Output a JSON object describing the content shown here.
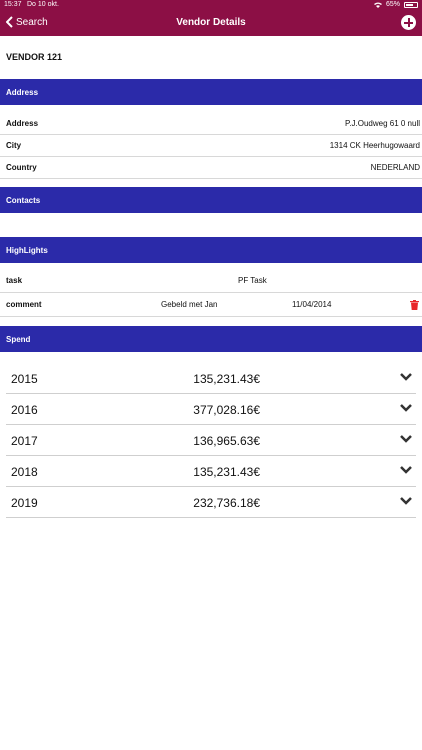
{
  "status": {
    "time": "15:37",
    "date": "Do 10 okt.",
    "battery": "65%"
  },
  "nav": {
    "back_label": "Search",
    "title": "Vendor Details"
  },
  "vendor": {
    "name": "VENDOR 121"
  },
  "address": {
    "header": "Address",
    "rows": [
      {
        "key": "Address",
        "value": "P.J.Oudweg 61 0 null"
      },
      {
        "key": "City",
        "value": "1314 CK Heerhugowaard"
      },
      {
        "key": "Country",
        "value": "NEDERLAND"
      }
    ]
  },
  "contacts": {
    "header": "Contacts"
  },
  "highlights": {
    "header": "HighLights",
    "task": {
      "key": "task",
      "value": "PF Task"
    },
    "comment": {
      "key": "comment",
      "text": "Gebeld met Jan",
      "date": "11/04/2014"
    }
  },
  "spend": {
    "header": "Spend",
    "rows": [
      {
        "year": "2015",
        "amount": "135,231.43€"
      },
      {
        "year": "2016",
        "amount": "377,028.16€"
      },
      {
        "year": "2017",
        "amount": "136,965.63€"
      },
      {
        "year": "2018",
        "amount": "135,231.43€"
      },
      {
        "year": "2019",
        "amount": "232,736.18€"
      }
    ]
  },
  "colors": {
    "brand": "#8c0f45",
    "section": "#2b2aa9",
    "delete": "#e8262a"
  },
  "icons": [
    "wifi-icon",
    "battery-icon",
    "back-chevron-icon",
    "add-icon",
    "trash-icon",
    "chevron-down-icon"
  ]
}
